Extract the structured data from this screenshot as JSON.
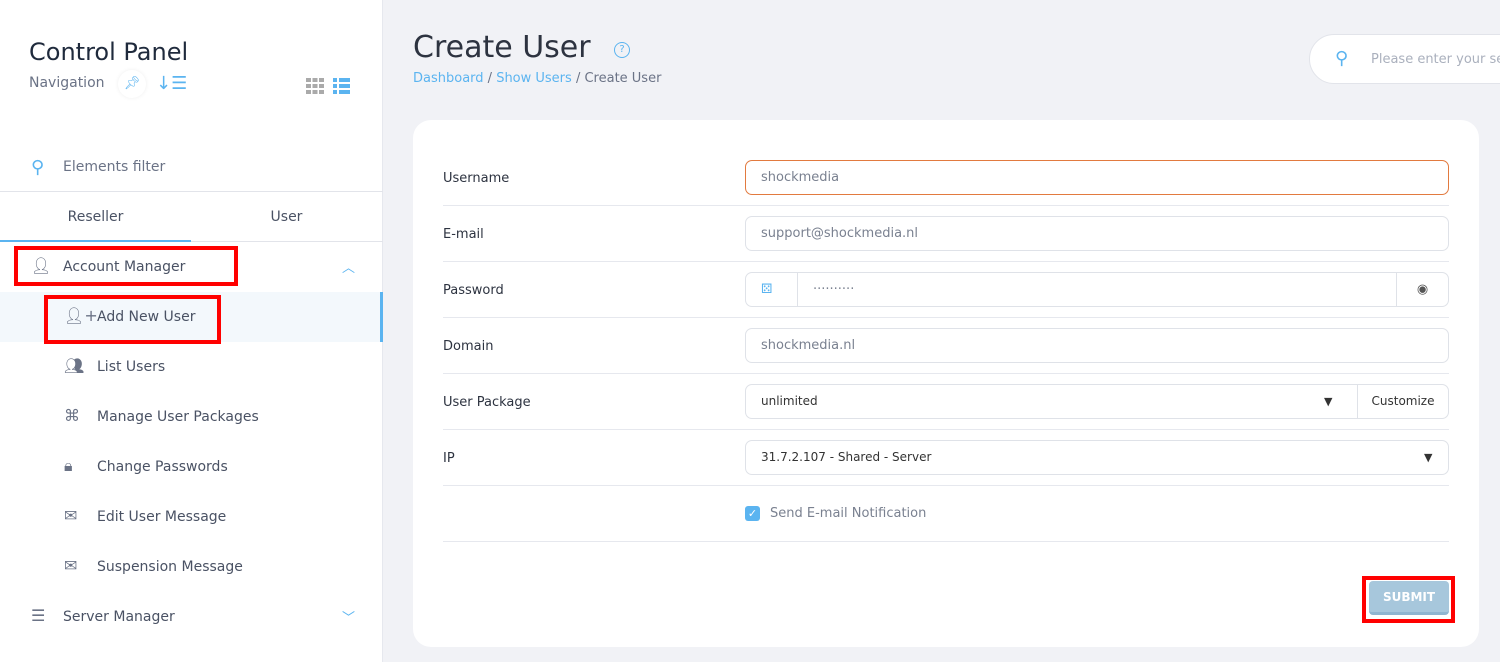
{
  "sidebar": {
    "title": "Control Panel",
    "navigation": "Navigation",
    "filter_placeholder": "Elements filter",
    "tabs": [
      "Reseller",
      "User"
    ],
    "items": [
      {
        "label": "Account Manager",
        "icon": "user-icon"
      },
      {
        "label": "Add New User",
        "icon": "user-plus-icon"
      },
      {
        "label": "List Users",
        "icon": "users-icon"
      },
      {
        "label": "Manage User Packages",
        "icon": "packages-icon"
      },
      {
        "label": "Change Passwords",
        "icon": "lock-icon"
      },
      {
        "label": "Edit User Message",
        "icon": "envelope-icon"
      },
      {
        "label": "Suspension Message",
        "icon": "envelope-icon"
      },
      {
        "label": "Server Manager",
        "icon": "server-icon"
      }
    ]
  },
  "header": {
    "title": "Create User",
    "breadcrumb": [
      "Dashboard",
      "Show Users",
      "Create User"
    ],
    "search_placeholder": "Please enter your search"
  },
  "form": {
    "username_label": "Username",
    "username": "shockmedia",
    "email_label": "E-mail",
    "email": "support@shockmedia.nl",
    "password_label": "Password",
    "password": "··········",
    "domain_label": "Domain",
    "domain": "shockmedia.nl",
    "package_label": "User Package",
    "package": "unlimited",
    "customize": "Customize",
    "ip_label": "IP",
    "ip": "31.7.2.107 - Shared - Server",
    "notify_label": "Send E-mail Notification",
    "notify_checked": true,
    "submit": "SUBMIT"
  },
  "colors": {
    "accent": "#5bb4f0",
    "highlight": "#ff0000"
  }
}
